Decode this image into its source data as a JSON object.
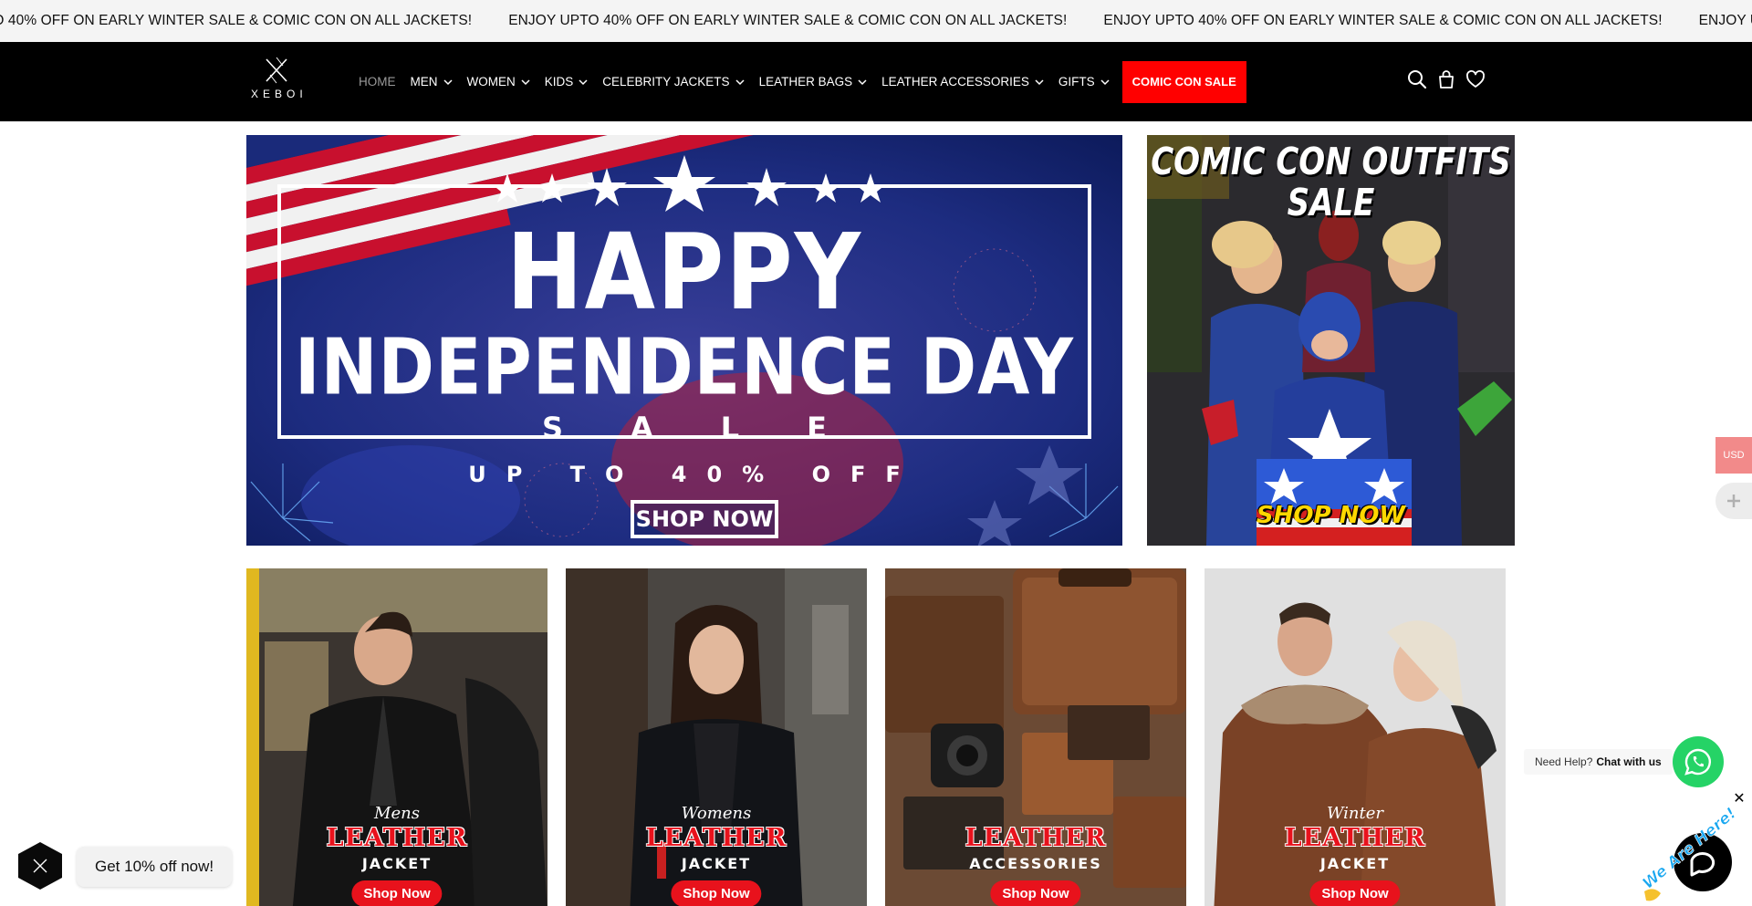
{
  "announcement": {
    "message": "ENJOY UPTO 40% OFF ON EARLY WINTER SALE & COMIC CON ON ALL JACKETS!"
  },
  "header": {
    "logo_text": "XEBOI",
    "nav": [
      {
        "label": "HOME",
        "has_dropdown": false
      },
      {
        "label": "MEN",
        "has_dropdown": true
      },
      {
        "label": "WOMEN",
        "has_dropdown": true
      },
      {
        "label": "KIDS",
        "has_dropdown": true
      },
      {
        "label": "CELEBRITY JACKETS",
        "has_dropdown": true
      },
      {
        "label": "LEATHER BAGS",
        "has_dropdown": true
      },
      {
        "label": "LEATHER ACCESSORIES",
        "has_dropdown": true
      },
      {
        "label": "GIFTS",
        "has_dropdown": true
      }
    ],
    "sale_label": "COMIC CON SALE",
    "icons": [
      "search-icon",
      "cart-icon",
      "wishlist-heart-icon"
    ]
  },
  "hero_left": {
    "line1": "HAPPY",
    "line2": "INDEPENDENCE DAY",
    "line3": "SALE",
    "line4": "UP TO 40% OFF",
    "button": "SHOP NOW"
  },
  "hero_right": {
    "title_line1": "COMIC CON OUTFITS",
    "title_line2": "SALE",
    "button": "SHOP NOW"
  },
  "categories": [
    {
      "title1": "Mens",
      "title2": "LEATHER",
      "title3": "JACKET",
      "button": "Shop Now"
    },
    {
      "title1": "Womens",
      "title2": "LEATHER",
      "title3": "JACKET",
      "button": "Shop Now"
    },
    {
      "title1": "",
      "title2": "LEATHER",
      "title3": "ACCESSORIES",
      "button": "Shop Now"
    },
    {
      "title1": "Winter",
      "title2": "LEATHER",
      "title3": "JACKET",
      "button": "Shop Now"
    }
  ],
  "widgets": {
    "currency": "USD",
    "help_prefix": "Need Help?",
    "help_link": "Chat with us",
    "close": "✕",
    "chat_badge": "We Are Here!",
    "promo": "Get 10% off now!"
  },
  "colors": {
    "header_bg": "#000000",
    "sale_bg": "#ff0000",
    "accent_red": "#e8121c",
    "whatsapp": "#25d366"
  }
}
